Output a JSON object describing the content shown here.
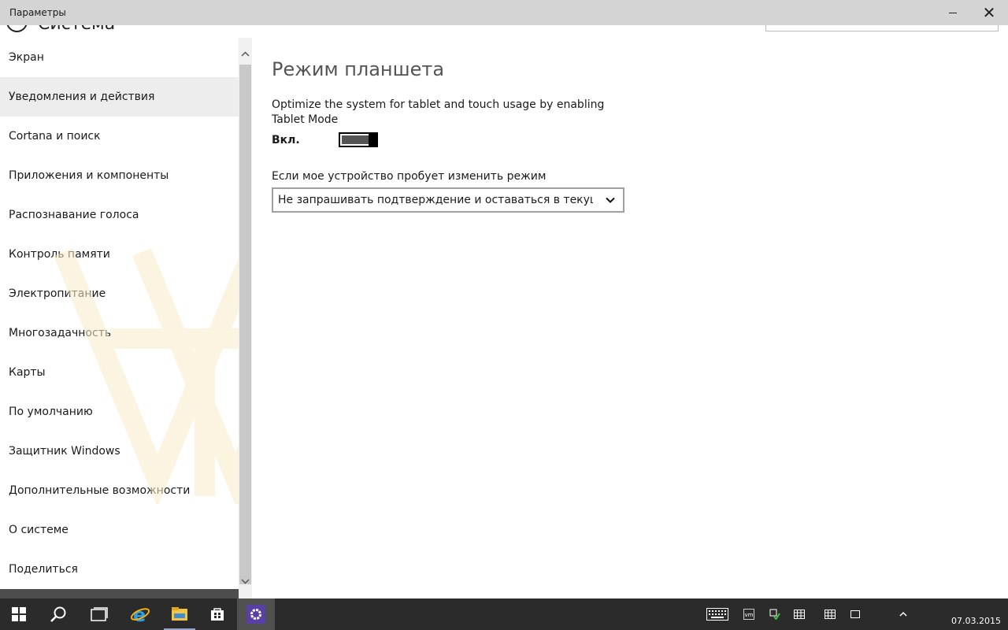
{
  "window": {
    "title": "Параметры",
    "header_title": "Система"
  },
  "sidebar": {
    "items": [
      {
        "label": "Экран",
        "selected": false
      },
      {
        "label": "Уведомления и действия",
        "selected": true
      },
      {
        "label": "Cortana и поиск",
        "selected": false
      },
      {
        "label": "Приложения и компоненты",
        "selected": false
      },
      {
        "label": "Распознавание голоса",
        "selected": false
      },
      {
        "label": "Контроль памяти",
        "selected": false
      },
      {
        "label": "Электропитание",
        "selected": false
      },
      {
        "label": "Многозадачность",
        "selected": false
      },
      {
        "label": "Карты",
        "selected": false
      },
      {
        "label": "По умолчанию",
        "selected": false
      },
      {
        "label": "Защитник Windows",
        "selected": false
      },
      {
        "label": "Дополнительные возможности",
        "selected": false
      },
      {
        "label": "О системе",
        "selected": false
      },
      {
        "label": "Поделиться",
        "selected": false
      }
    ]
  },
  "content": {
    "page_title": "Режим планшета",
    "description": "Optimize the system for tablet and touch usage by enabling Tablet Mode",
    "toggle": {
      "label": "Вкл.",
      "on": true
    },
    "dropdown": {
      "label": "Если мое устройство пробует изменить режим",
      "value": "Не запрашивать подтверждение и оставаться в текущем..."
    }
  },
  "taskbar": {
    "apps": [
      "start-icon",
      "search-icon",
      "task-view-icon",
      "internet-explorer-icon",
      "file-explorer-icon",
      "store-icon",
      "settings-icon"
    ],
    "active_app": "settings-icon",
    "tray": [
      "keyboard-icon",
      "vm-icon",
      "network-icon",
      "keyboard-layout-icon",
      "keyboard-layout-icon",
      "notification-icon",
      "chevron-up-icon"
    ],
    "date": "07.03.2015"
  },
  "colors": {
    "titlebar": "#d4d4d4",
    "taskbar": "#2b2b2b",
    "selected_item": "#ededed",
    "settings_accent": "#5a3fa6"
  }
}
